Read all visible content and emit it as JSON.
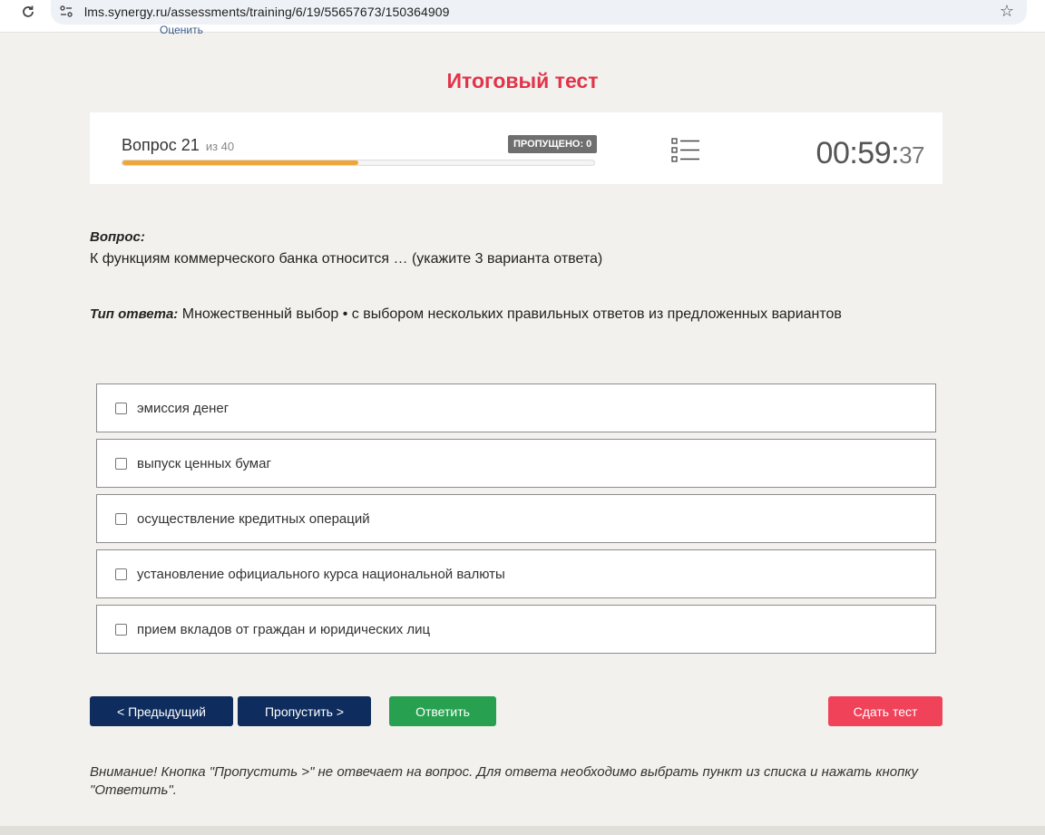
{
  "browser": {
    "url": "lms.synergy.ru/assessments/training/6/19/55657673/150364909"
  },
  "partial_link": "Оценить",
  "page_title": "Итоговый тест",
  "progress": {
    "question_label": "Вопрос 21",
    "of_label": "из 40",
    "current": 21,
    "total": 40,
    "fraction": 0.5,
    "skipped_badge": "ПРОПУЩЕНО: 0",
    "timer_main": "00:59:",
    "timer_seconds": "37"
  },
  "question": {
    "label": "Вопрос:",
    "text": "К функциям коммерческого банка относится … (укажите 3 варианта ответа)"
  },
  "answer_type": {
    "label": "Тип ответа:",
    "text": "Множественный выбор • с выбором нескольких правильных ответов из предложенных вариантов"
  },
  "options": [
    {
      "label": "эмиссия денег",
      "checked": false
    },
    {
      "label": "выпуск ценных бумаг",
      "checked": false
    },
    {
      "label": "осуществление кредитных операций",
      "checked": false
    },
    {
      "label": "установление официального курса национальной валюты",
      "checked": false
    },
    {
      "label": "прием вкладов от граждан и юридических лиц",
      "checked": false
    }
  ],
  "buttons": {
    "prev": "< Предыдущий",
    "skip": "Пропустить >",
    "answer": "Ответить",
    "submit": "Сдать тест"
  },
  "notice": "Внимание! Кнопка \"Пропустить >\" не отвечает на вопрос. Для ответа необходимо выбрать пункт из списка и нажать кнопку \"Ответить\".",
  "colors": {
    "title": "#e2334a",
    "progress_fill": "#f0a636",
    "nav_button": "#0e2d5e",
    "answer_button": "#27a150",
    "submit_button": "#f0435a"
  }
}
